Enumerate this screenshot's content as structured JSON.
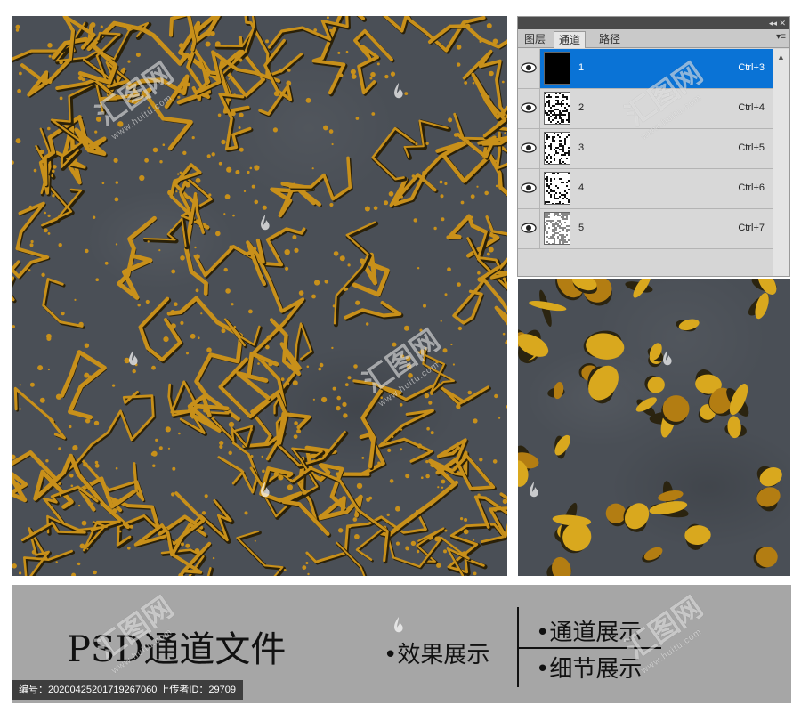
{
  "panel": {
    "tabs": [
      {
        "label": "图层"
      },
      {
        "label": "通道"
      },
      {
        "label": "路径"
      }
    ],
    "active_tab": 1,
    "channels": [
      {
        "name": "1",
        "shortcut": "Ctrl+3",
        "selected": true
      },
      {
        "name": "2",
        "shortcut": "Ctrl+4",
        "selected": false
      },
      {
        "name": "3",
        "shortcut": "Ctrl+5",
        "selected": false
      },
      {
        "name": "4",
        "shortcut": "Ctrl+6",
        "selected": false
      },
      {
        "name": "5",
        "shortcut": "Ctrl+7",
        "selected": false
      }
    ],
    "topbar_icons": "◂◂ ✕",
    "menu_icon": "▾≡"
  },
  "banner": {
    "title": "PSD通道文件",
    "effect_label": "•效果展示",
    "channel_label": "•通道展示",
    "detail_label": "•细节展示",
    "meta": "编号：20200425201719267060 上传者ID：29709"
  },
  "watermark": {
    "logo_text": "汇图网",
    "url_text": "www.huitu.com"
  },
  "colors": {
    "texture_base": "#4a4f56",
    "gold": "#c8901a",
    "selection_blue": "#0a73d6",
    "banner_gray": "#a6a6a6"
  },
  "icons": {
    "eye": "eye-icon",
    "scroll_up": "chevron-up-icon",
    "watermark_drop": "flame-logo-icon"
  }
}
